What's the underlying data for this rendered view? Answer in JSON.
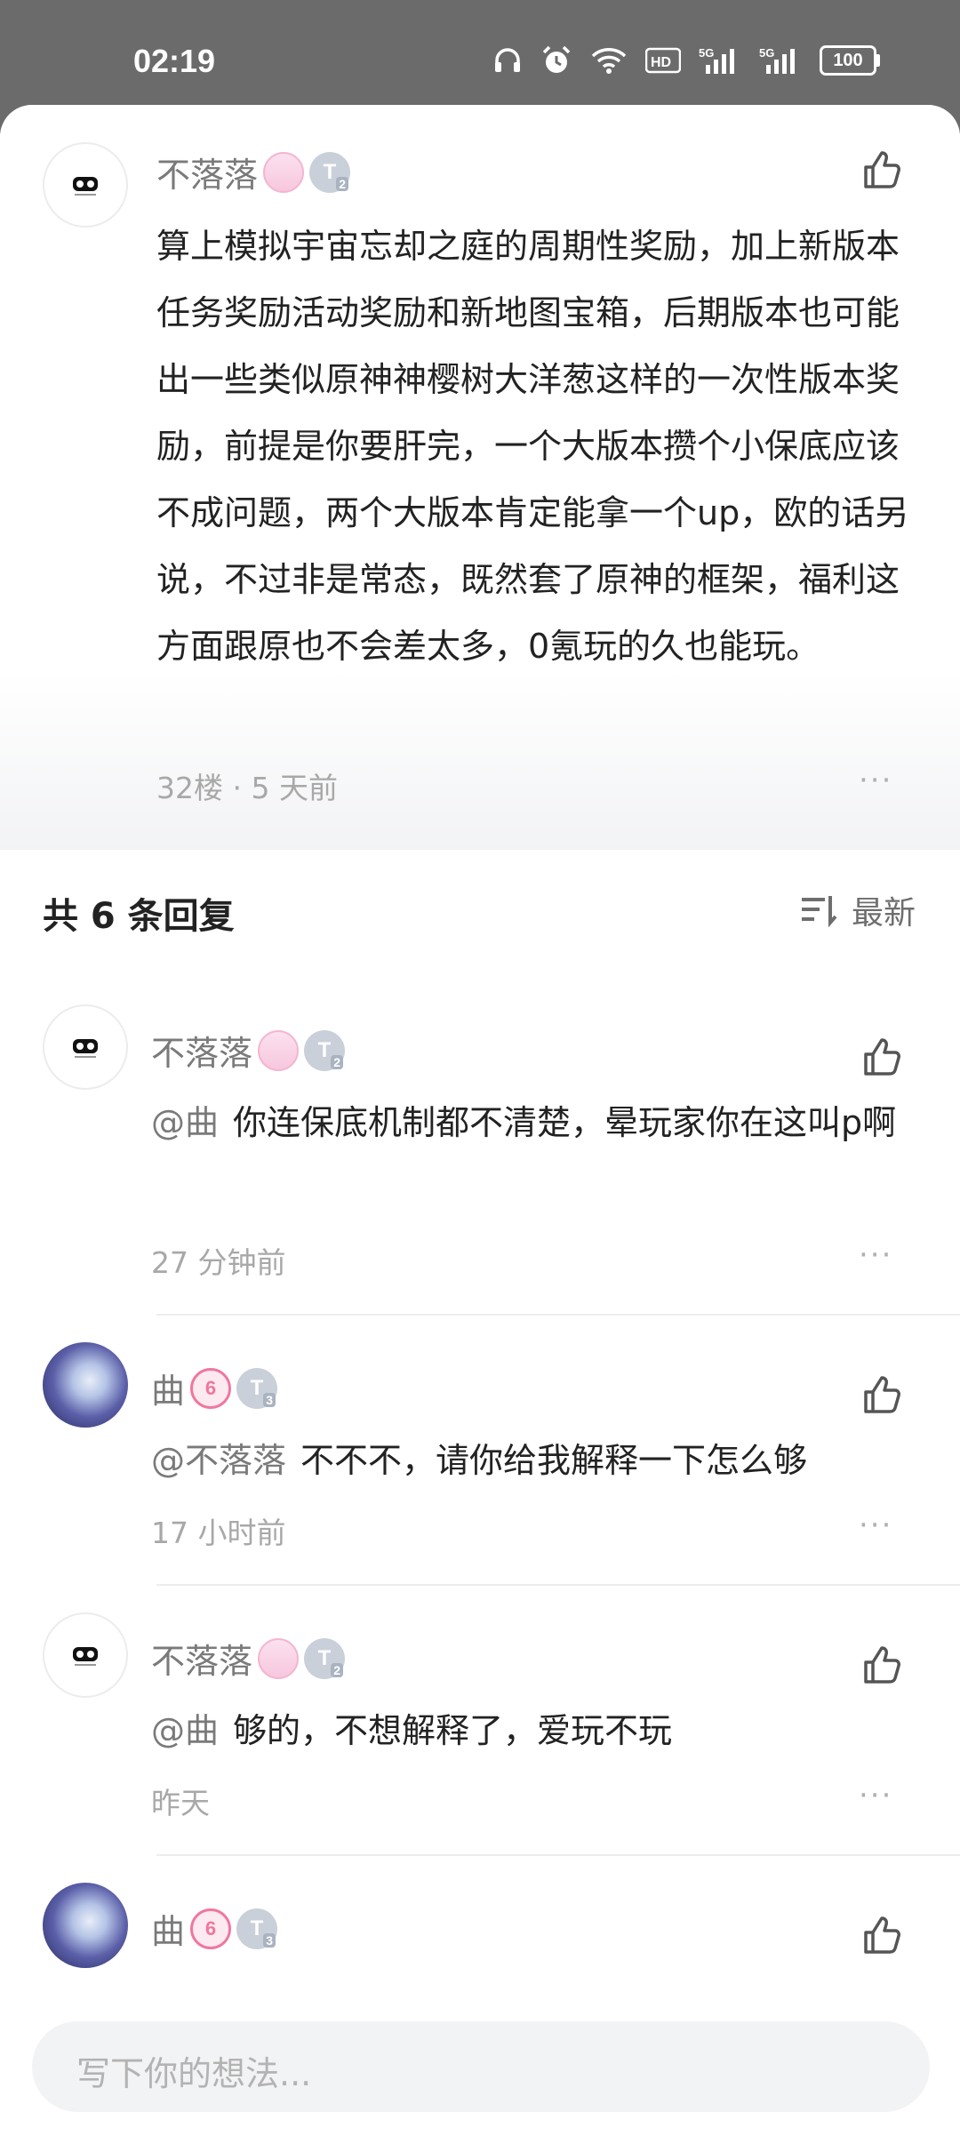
{
  "status_bar": {
    "time": "02:19",
    "network_1": "HD",
    "network_2": "5G",
    "network_3": "5G",
    "battery": "100"
  },
  "main_post": {
    "username": "不落落",
    "level": "T",
    "level_sub": "2",
    "content": "算上模拟宇宙忘却之庭的周期性奖励，加上新版本任务奖励活动奖励和新地图宝箱，后期版本也可能出一些类似原神神樱树大洋葱这样的一次性版本奖励，前提是你要肝完，一个大版本攒个小保底应该不成问题，两个大版本肯定能拿一个up，欧的话另说，不过非是常态，既然套了原神的框架，福利这方面跟原也不会差太多，0氪玩的久也能玩。",
    "meta": "32楼 · 5 天前",
    "more": "···"
  },
  "replies_header": {
    "count_label": "共 6 条回复",
    "sort_label": "最新"
  },
  "replies": [
    {
      "username": "不落落",
      "level": "T",
      "level_sub": "2",
      "mention": "@曲",
      "text": "你连保底机制都不清楚，晕玩家你在这叫p啊",
      "time": "27 分钟前",
      "more": "···"
    },
    {
      "username": "曲",
      "level": "T",
      "level_sub": "3",
      "badge": "6",
      "mention": "@不落落",
      "text": "不不不，请你给我解释一下怎么够",
      "time": "17 小时前",
      "more": "···"
    },
    {
      "username": "不落落",
      "level": "T",
      "level_sub": "2",
      "mention": "@曲",
      "text": "够的，不想解释了，爱玩不玩",
      "time": "昨天",
      "more": "···"
    },
    {
      "username": "曲",
      "level": "T",
      "level_sub": "3",
      "badge": "6"
    }
  ],
  "input": {
    "placeholder": "写下你的想法..."
  }
}
